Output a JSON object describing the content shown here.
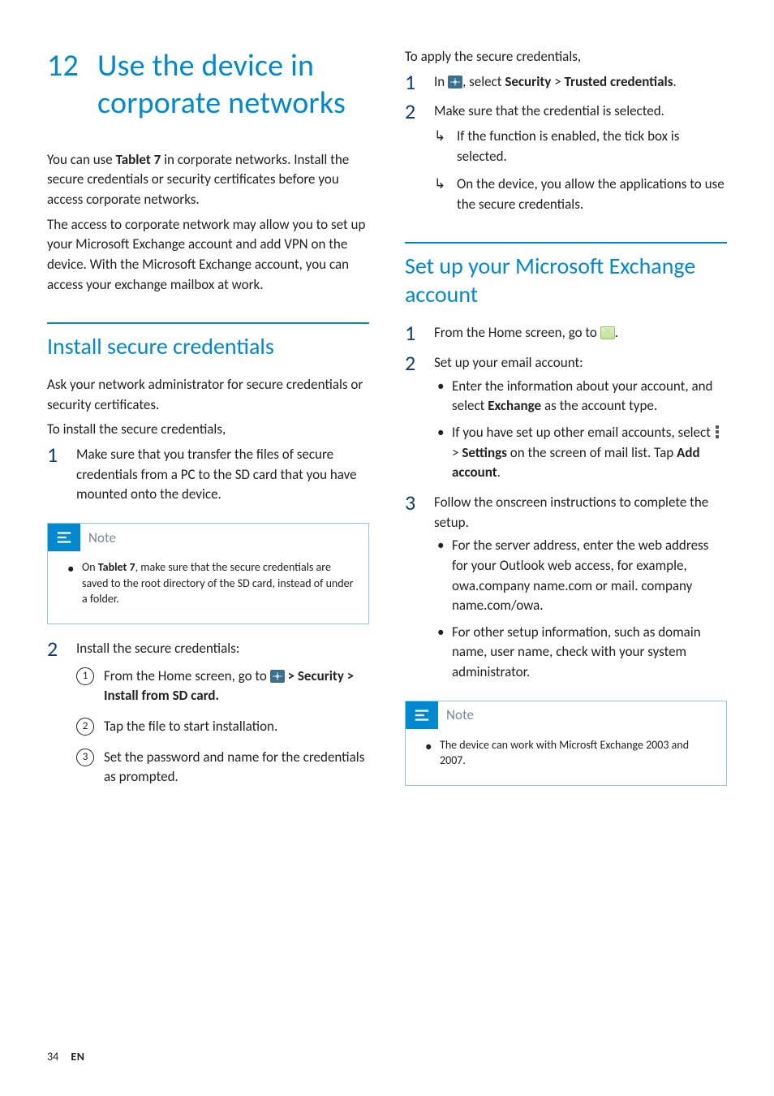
{
  "chapter": {
    "number": "12",
    "title": "Use the device in corporate networks"
  },
  "left": {
    "intro1_a": "You can use ",
    "intro1_b": "Tablet 7",
    "intro1_c": " in corporate networks. Install the secure credentials or security certificates before you access corporate networks.",
    "intro2": "The access to corporate network may allow you to set up your Microsoft Exchange account and add VPN on the device. With the Microsoft Exchange account, you can access your exchange mailbox at work.",
    "section1_title": "Install secure credentials",
    "s1_p1": "Ask your network administrator for secure credentials or security certificates.",
    "s1_p2": "To install the secure credentials,",
    "s1_step1": "Make sure that you transfer the files of secure credentials from a PC to the SD card that you have mounted onto the device.",
    "note_label": "Note",
    "note1_a": "On ",
    "note1_b": "Tablet 7",
    "note1_c": ", make sure that the secure credentials are saved to the root directory of the SD card, instead of under a folder.",
    "s1_step2": "Install the secure credentials:",
    "s1_c1_a": "From the Home screen, go to ",
    "s1_c1_b": " > Security > Install from SD card.",
    "s1_c2": "Tap the file to start installation.",
    "s1_c3": "Set the password and name for the credentials as prompted."
  },
  "right": {
    "apply_heading": "To apply the secure credentials,",
    "apply_s1_a": "In ",
    "apply_s1_b": ", select ",
    "apply_s1_c": "Security",
    "apply_s1_d": " > ",
    "apply_s1_e": "Trusted credentials",
    "apply_s1_f": ".",
    "apply_s2": "Make sure that the credential is selected.",
    "apply_s2_arrow1": "If the function is enabled, the tick box is selected.",
    "apply_s2_arrow2": "On the device, you allow the applications to use the secure credentials.",
    "section2_title": "Set up your Microsoft Exchange account",
    "ex_s1_a": "From the Home screen, go to ",
    "ex_s1_b": ".",
    "ex_s2": "Set up your email account:",
    "ex_s2_b1_a": "Enter the information about your account, and select ",
    "ex_s2_b1_b": "Exchange",
    "ex_s2_b1_c": " as the account type.",
    "ex_s2_b2_a": "If you have set up other email accounts, select ",
    "ex_s2_b2_b": " > ",
    "ex_s2_b2_c": "Settings",
    "ex_s2_b2_d": " on the screen of mail list. Tap ",
    "ex_s2_b2_e": "Add account",
    "ex_s2_b2_f": ".",
    "ex_s3": "Follow the onscreen instructions to complete the setup.",
    "ex_s3_b1": "For the server address, enter the web address for your Outlook web access, for example, owa.company name.com or mail. company name.com/owa.",
    "ex_s3_b2": "For other setup information, such as domain name, user name, check with your system administrator.",
    "note2": "The device can work with Microsft Exchange 2003 and 2007."
  },
  "footer": {
    "page": "34",
    "lang": "EN"
  }
}
